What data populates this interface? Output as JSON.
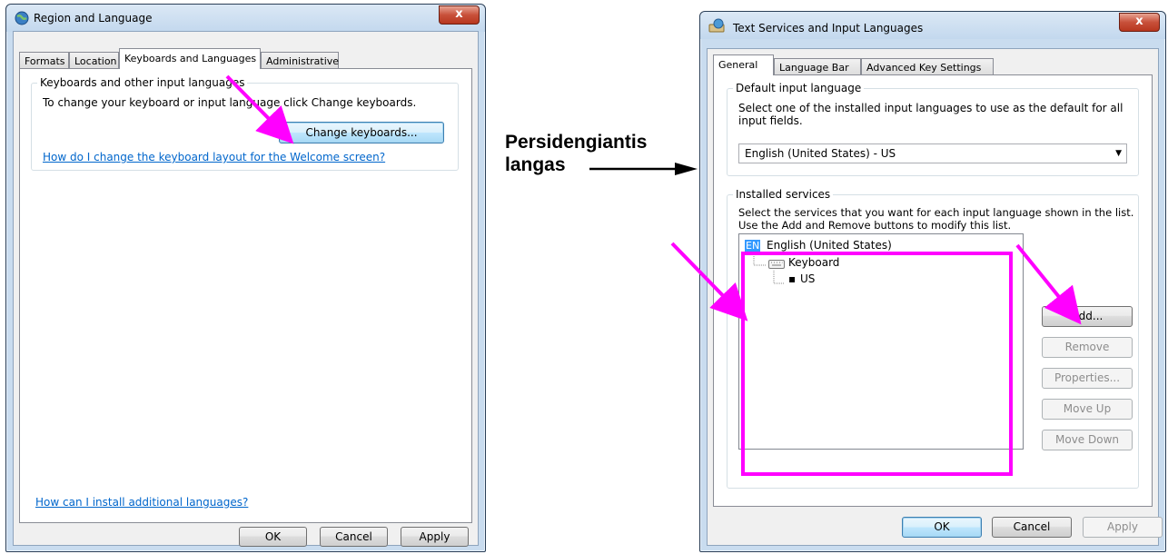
{
  "left_window": {
    "title": "Region and Language",
    "close_label": "x",
    "tabs": [
      {
        "label": "Formats"
      },
      {
        "label": "Location"
      },
      {
        "label": "Keyboards and Languages",
        "active": true
      },
      {
        "label": "Administrative"
      }
    ],
    "group_title": "Keyboards and other input languages",
    "instruction": "To change your keyboard or input language click Change keyboards.",
    "change_keyboards_button": "Change keyboards...",
    "welcome_link": "How do I change the keyboard layout for the Welcome screen?",
    "install_link": "How can I install additional languages?",
    "buttons": {
      "ok": "OK",
      "cancel": "Cancel",
      "apply": "Apply"
    }
  },
  "annotation": {
    "line1": "Persidengiantis",
    "line2": "langas",
    "highlight_color": "#ff00ff"
  },
  "right_window": {
    "title": "Text Services and Input Languages",
    "close_label": "x",
    "tabs": [
      {
        "label": "General",
        "active": true
      },
      {
        "label": "Language Bar"
      },
      {
        "label": "Advanced Key Settings"
      }
    ],
    "default_group_title": "Default input language",
    "default_description": "Select one of the installed input languages to use as the default for all input fields.",
    "default_selected": "English (United States) - US",
    "installed_group_title": "Installed services",
    "installed_description_line1": "Select the services that you want for each input language shown in the list.",
    "installed_description_line2": "Use the Add and Remove buttons to modify this list.",
    "tree": {
      "lang_badge": "EN",
      "language": "English (United States)",
      "category": "Keyboard",
      "layout": "US"
    },
    "side_buttons": {
      "add": "Add...",
      "remove": "Remove",
      "properties": "Properties...",
      "move_up": "Move Up",
      "move_down": "Move Down"
    },
    "buttons": {
      "ok": "OK",
      "cancel": "Cancel",
      "apply": "Apply"
    }
  }
}
